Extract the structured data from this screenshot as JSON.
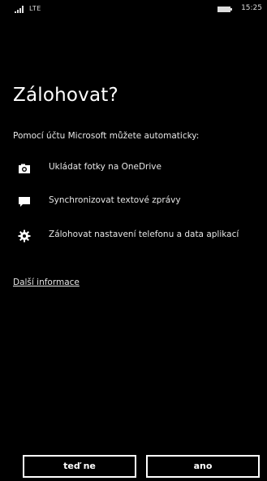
{
  "status_bar": {
    "network": "LTE",
    "time": "15:25",
    "icons": [
      "signal-icon",
      "battery-icon"
    ]
  },
  "title": "Zálohovat?",
  "intro": "Pomocí účtu Microsoft můžete automaticky:",
  "features": [
    {
      "icon": "camera-icon",
      "label": "Ukládat fotky na OneDrive"
    },
    {
      "icon": "message-icon",
      "label": "Synchronizovat textové zprávy"
    },
    {
      "icon": "gear-icon",
      "label": "Zálohovat nastavení telefonu a data aplikací"
    }
  ],
  "more_info_link": "Další informace",
  "buttons": {
    "not_now": "teď ne",
    "yes": "ano"
  }
}
